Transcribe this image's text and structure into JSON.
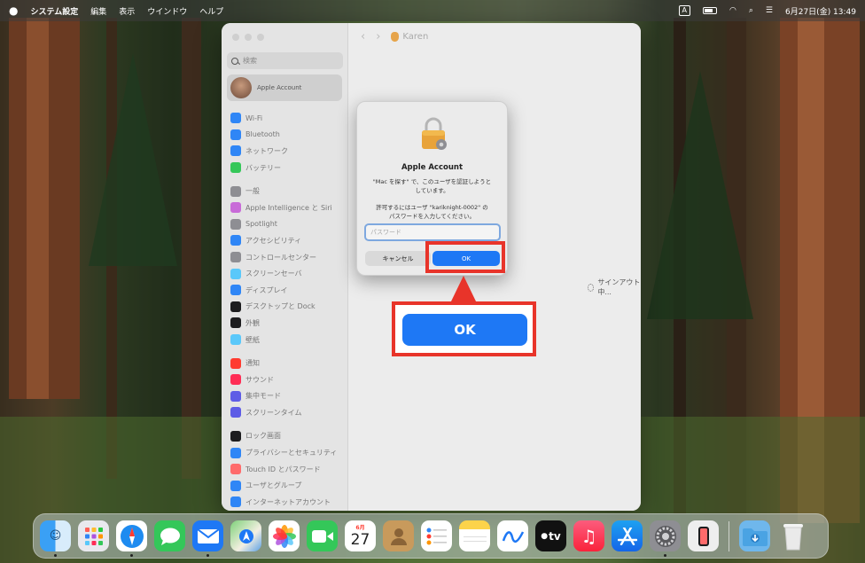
{
  "menubar": {
    "apple_icon": "apple-logo-icon",
    "app_name": "システム設定",
    "menus": [
      "編集",
      "表示",
      "ウインドウ",
      "ヘルプ"
    ],
    "input_indicator": "A",
    "datetime": "6月27日(金)  13:49"
  },
  "window": {
    "search_placeholder": "検索",
    "account_label": "Apple Account",
    "nav_items": [
      {
        "label": "Wi-Fi",
        "color": "#2f86f6"
      },
      {
        "label": "Bluetooth",
        "color": "#2f86f6"
      },
      {
        "label": "ネットワーク",
        "color": "#2f86f6"
      },
      {
        "label": "バッテリー",
        "color": "#35c759"
      },
      {
        "label": "一般",
        "color": "#8e8e93"
      },
      {
        "label": "Apple Intelligence と Siri",
        "color": "#c86bd8"
      },
      {
        "label": "Spotlight",
        "color": "#8e8e93"
      },
      {
        "label": "アクセシビリティ",
        "color": "#2f86f6"
      },
      {
        "label": "コントロールセンター",
        "color": "#8e8e93"
      },
      {
        "label": "スクリーンセーバ",
        "color": "#5ac8fa"
      },
      {
        "label": "ディスプレイ",
        "color": "#2f86f6"
      },
      {
        "label": "デスクトップと Dock",
        "color": "#1c1c1e"
      },
      {
        "label": "外観",
        "color": "#1c1c1e"
      },
      {
        "label": "壁紙",
        "color": "#5ac8fa"
      },
      {
        "label": "通知",
        "color": "#ff3b30"
      },
      {
        "label": "サウンド",
        "color": "#ff2d55"
      },
      {
        "label": "集中モード",
        "color": "#5e5ce6"
      },
      {
        "label": "スクリーンタイム",
        "color": "#5e5ce6"
      },
      {
        "label": "ロック画面",
        "color": "#1c1c1e"
      },
      {
        "label": "プライバシーとセキュリティ",
        "color": "#2f86f6"
      },
      {
        "label": "Touch ID とパスワード",
        "color": "#ff6b6b"
      },
      {
        "label": "ユーザとグループ",
        "color": "#2f86f6"
      },
      {
        "label": "インターネットアカウント",
        "color": "#2f86f6"
      }
    ],
    "user_name": "Karen",
    "signout_text": "サインアウト中..."
  },
  "dialog": {
    "title": "Apple Account",
    "message": "\"Mac を探す\" で、このユーザを認証しようと\nしています。",
    "message2": "許可するにはユーザ \"kariknight-0002\" の\nパスワードを入力してください。",
    "password_placeholder": "パスワード",
    "cancel_label": "キャンセル",
    "ok_label": "OK"
  },
  "callout": {
    "ok_label": "OK",
    "highlight_color": "#e8342a"
  },
  "dock": {
    "calendar_month": "6月",
    "calendar_day": "27",
    "tv_label": "tv",
    "apps": [
      "Finder",
      "Launchpad",
      "Safari",
      "Messages",
      "Mail",
      "Maps",
      "Photos",
      "FaceTime",
      "Calendar",
      "Contacts",
      "Reminders",
      "Notes",
      "Freeform",
      "TV",
      "Music",
      "App Store",
      "System Settings",
      "iPhone Mirroring",
      "Downloads",
      "Trash"
    ]
  }
}
